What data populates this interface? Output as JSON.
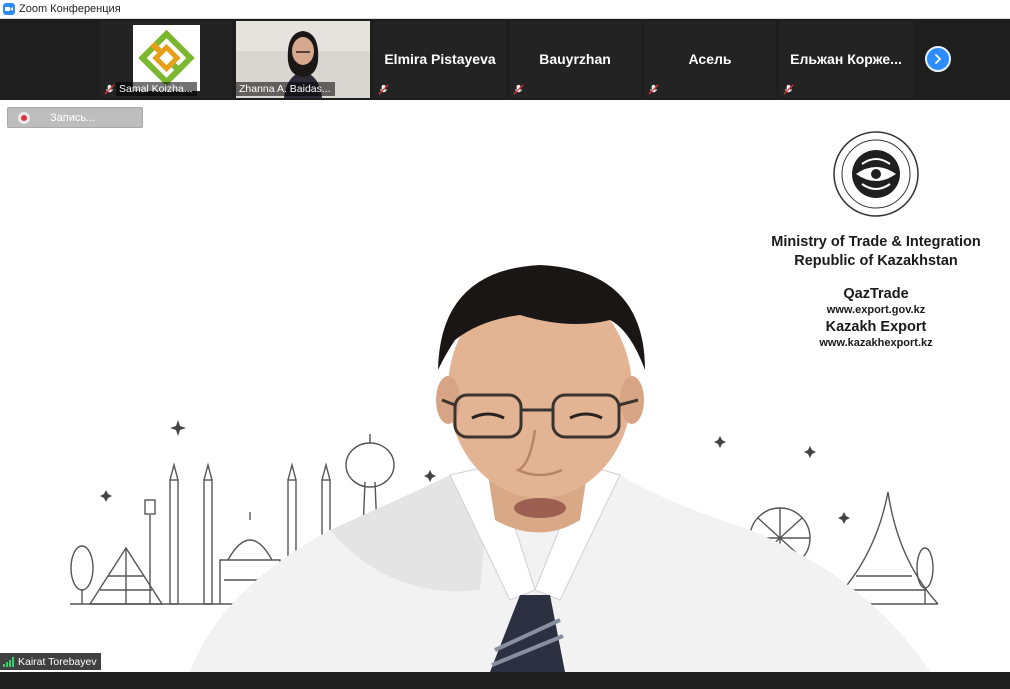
{
  "window": {
    "title": "Zoom Конференция"
  },
  "participants": [
    {
      "name": "Samal Koizha...",
      "kind": "logo"
    },
    {
      "name": "Zhanna A. Baidas...",
      "kind": "video"
    },
    {
      "name": "Elmira Pistayeva",
      "kind": "name"
    },
    {
      "name": "Bauyrzhan",
      "kind": "name"
    },
    {
      "name": "Асель",
      "kind": "name"
    },
    {
      "name": "Ельжан  Корже...",
      "kind": "name"
    }
  ],
  "recording": {
    "label": "Запись..."
  },
  "main_video": {
    "ministry_line1": "Ministry of Trade & Integration",
    "ministry_line2": "Republic of Kazakhstan",
    "brand1": "QazTrade",
    "url1": "www.export.gov.kz",
    "brand2": "Kazakh Export",
    "url2": "www.kazakhexport.kz",
    "speaker": "Kairat Torebayev"
  },
  "colors": {
    "accent": "#2d8cff",
    "mute_red": "#e0313c",
    "signal_green": "#3bd16f"
  },
  "icons": {
    "mute": "microphone-muted-icon",
    "next": "chevron-right-icon",
    "record": "record-icon",
    "signal": "signal-strength-icon"
  }
}
